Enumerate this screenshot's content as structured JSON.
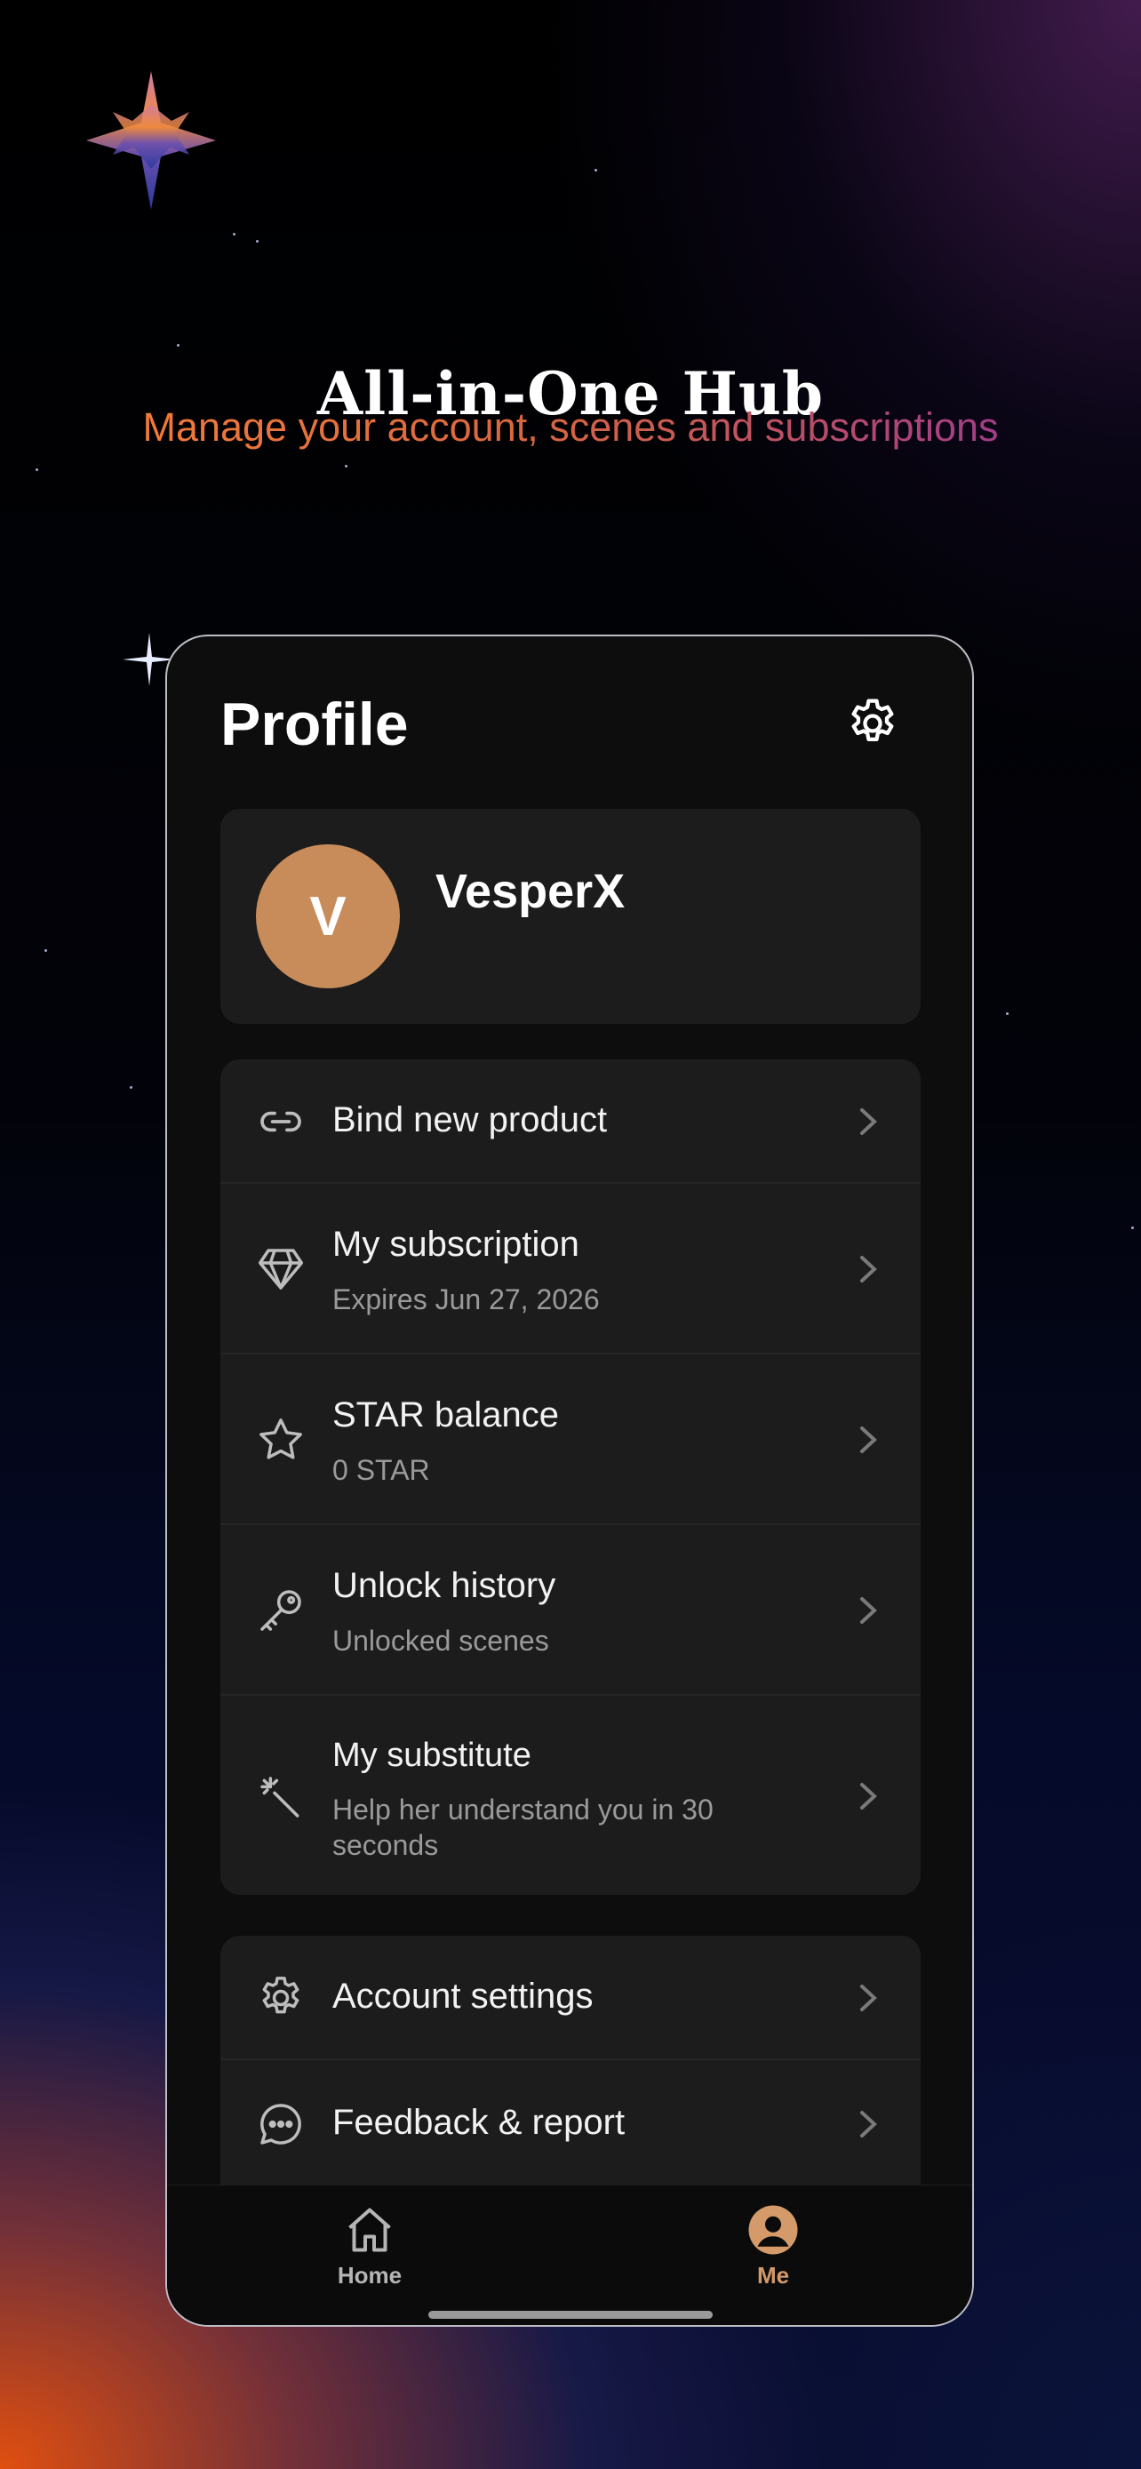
{
  "hero": {
    "title": "All-in-One Hub",
    "subtitle": "Manage your account, scenes and subscriptions"
  },
  "profile": {
    "title": "Profile",
    "settings_icon": "gear-icon"
  },
  "user": {
    "avatar_letter": "V",
    "avatar_color": "#c88c5b",
    "name": "VesperX"
  },
  "menu_primary": [
    {
      "label": "Bind new product",
      "icon": "link-icon"
    },
    {
      "label": "My subscription",
      "sublabel": "Expires Jun 27, 2026",
      "icon": "diamond-icon"
    },
    {
      "label": "STAR balance",
      "sublabel": "0 STAR",
      "icon": "star-icon"
    },
    {
      "label": "Unlock history",
      "sublabel": "Unlocked scenes",
      "icon": "key-icon"
    },
    {
      "label": "My substitute",
      "sublabel": "Help her understand you in 30 seconds",
      "icon": "magic-wand-icon"
    }
  ],
  "menu_secondary": [
    {
      "label": "Account settings",
      "icon": "gear-icon"
    },
    {
      "label": "Feedback & report",
      "icon": "chat-bubble-icon"
    }
  ],
  "tabbar": {
    "home_label": "Home",
    "me_label": "Me",
    "active_tab": "Me",
    "active_color": "#d49a6a",
    "inactive_color": "#b5b5b5"
  }
}
